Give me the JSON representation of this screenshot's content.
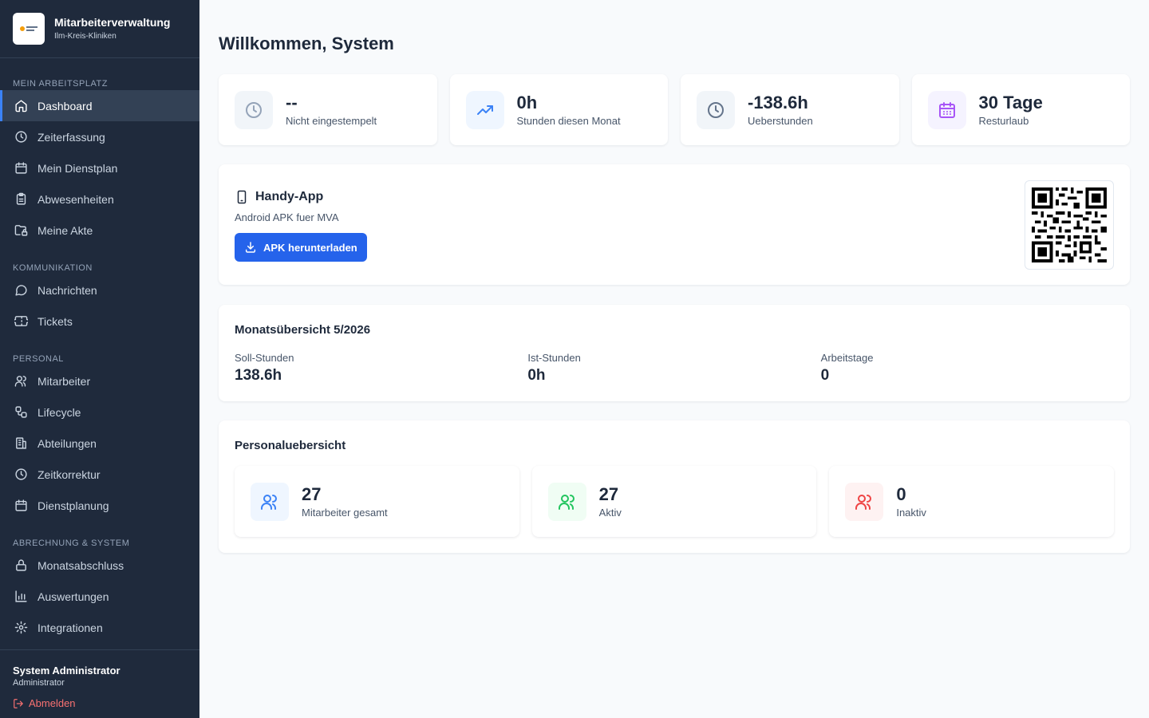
{
  "app": {
    "title": "Mitarbeiterverwaltung",
    "subtitle": "Ilm-Kreis-Kliniken"
  },
  "sidebar": {
    "sections": [
      {
        "title": "MEIN ARBEITSPLATZ",
        "items": [
          {
            "label": "Dashboard",
            "icon": "home-icon",
            "active": true
          },
          {
            "label": "Zeiterfassung",
            "icon": "clock-icon"
          },
          {
            "label": "Mein Dienstplan",
            "icon": "calendar-icon"
          },
          {
            "label": "Abwesenheiten",
            "icon": "clipboard-icon"
          },
          {
            "label": "Meine Akte",
            "icon": "folder-lock-icon"
          }
        ]
      },
      {
        "title": "KOMMUNIKATION",
        "items": [
          {
            "label": "Nachrichten",
            "icon": "message-icon"
          },
          {
            "label": "Tickets",
            "icon": "ticket-icon"
          }
        ]
      },
      {
        "title": "PERSONAL",
        "items": [
          {
            "label": "Mitarbeiter",
            "icon": "user-icon"
          },
          {
            "label": "Lifecycle",
            "icon": "workflow-icon"
          },
          {
            "label": "Abteilungen",
            "icon": "building-icon"
          },
          {
            "label": "Zeitkorrektur",
            "icon": "clock-icon"
          },
          {
            "label": "Dienstplanung",
            "icon": "calendar-icon"
          }
        ]
      },
      {
        "title": "ABRECHNUNG & SYSTEM",
        "items": [
          {
            "label": "Monatsabschluss",
            "icon": "lock-icon"
          },
          {
            "label": "Auswertungen",
            "icon": "bar-chart-icon"
          },
          {
            "label": "Integrationen",
            "icon": "gear-icon"
          }
        ]
      }
    ],
    "user": {
      "name": "System Administrator",
      "role": "Administrator",
      "logout_label": "Abmelden"
    }
  },
  "main": {
    "title": "Willkommen, System",
    "stats": [
      {
        "value": "--",
        "label": "Nicht eingestempelt",
        "icon": "clock-icon",
        "icon_color": "#94a3b8",
        "icon_bg": "#f1f5f9"
      },
      {
        "value": "0h",
        "label": "Stunden diesen Monat",
        "icon": "trending-up-icon",
        "icon_color": "#3b82f6",
        "icon_bg": "#eff6ff"
      },
      {
        "value": "-138.6h",
        "label": "Ueberstunden",
        "icon": "clock-icon",
        "icon_color": "#64748b",
        "icon_bg": "#f1f5f9"
      },
      {
        "value": "30 Tage",
        "label": "Resturlaub",
        "icon": "calendar-icon",
        "icon_color": "#a855f7",
        "icon_bg": "#f5f3ff"
      }
    ],
    "app_card": {
      "title": "Handy-App",
      "subtitle": "Android APK fuer MVA",
      "button_label": "APK herunterladen"
    },
    "month": {
      "title": "Monatsübersicht 5/2026",
      "columns": [
        {
          "label": "Soll-Stunden",
          "value": "138.6h"
        },
        {
          "label": "Ist-Stunden",
          "value": "0h"
        },
        {
          "label": "Arbeitstage",
          "value": "0"
        }
      ]
    },
    "personal": {
      "title": "Personaluebersicht",
      "cards": [
        {
          "value": "27",
          "label": "Mitarbeiter gesamt",
          "icon": "users-icon",
          "icon_color": "#3b82f6",
          "icon_bg": "#eff6ff"
        },
        {
          "value": "27",
          "label": "Aktiv",
          "icon": "users-icon",
          "icon_color": "#22c55e",
          "icon_bg": "#f0fdf4"
        },
        {
          "value": "0",
          "label": "Inaktiv",
          "icon": "users-icon",
          "icon_color": "#ef4444",
          "icon_bg": "#fef2f2"
        }
      ]
    }
  },
  "colors": {
    "sidebar_bg": "#1f2a3c",
    "accent": "#2563eb",
    "page_bg": "#f8fafc",
    "logout": "#f87171"
  }
}
